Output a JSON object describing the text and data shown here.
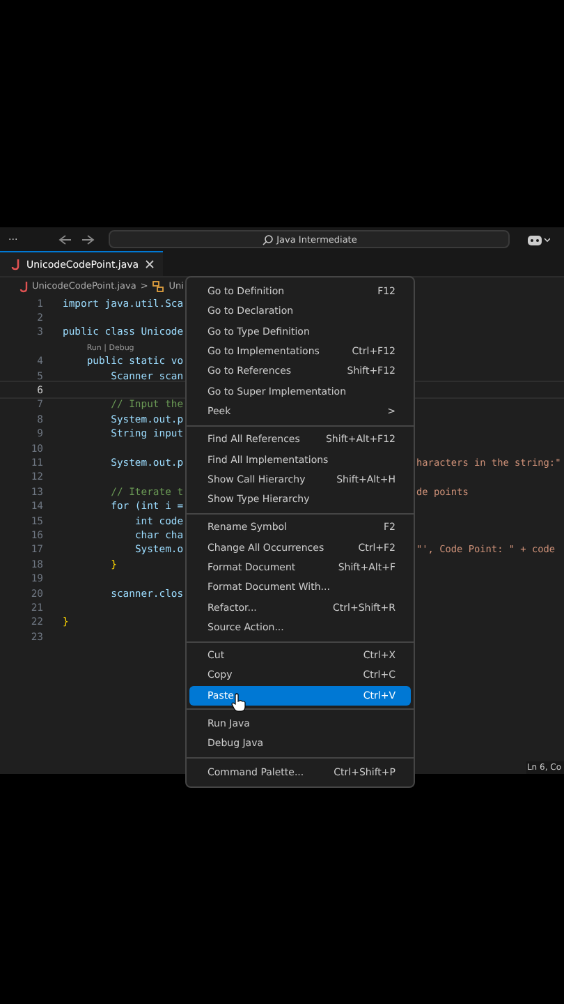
{
  "title_bar": {
    "more": "···",
    "search": "Java Intermediate"
  },
  "tabs": [
    {
      "label": "UnicodeCodePoint.java",
      "selected": true
    }
  ],
  "breadcrumb": {
    "file": "UnicodeCodePoint.java",
    "separator": ">",
    "symbol": "Uni"
  },
  "editor": {
    "lines": [
      {
        "kind": "code",
        "number": "1",
        "text": "import java.util.Sca",
        "current": false
      },
      {
        "kind": "code",
        "number": "2",
        "current": false
      },
      {
        "kind": "code",
        "number": "3",
        "text": "public class Unicode",
        "current": false
      },
      {
        "kind": "lens",
        "text": "    Run | Debug"
      },
      {
        "kind": "code",
        "number": "4",
        "text": "    public static vo",
        "current": false
      },
      {
        "kind": "code",
        "number": "5",
        "text": "        Scanner scan",
        "current": false
      },
      {
        "kind": "code",
        "number": "6",
        "current": true
      },
      {
        "kind": "code",
        "number": "7",
        "text": "        // Input the",
        "current": false
      },
      {
        "kind": "code",
        "number": "8",
        "text": "        System.out.p",
        "current": false
      },
      {
        "kind": "code",
        "number": "9",
        "text": "        String input",
        "current": false
      },
      {
        "kind": "code",
        "number": "10",
        "current": false
      },
      {
        "kind": "code",
        "number": "11",
        "text": "        System.out.p",
        "right": "haracters in the string:\"",
        "current": false
      },
      {
        "kind": "code",
        "number": "12",
        "current": false
      },
      {
        "kind": "code",
        "number": "13",
        "text": "        // Iterate t",
        "right": "de points",
        "current": false
      },
      {
        "kind": "code",
        "number": "14",
        "text": "        for (int i =",
        "current": false
      },
      {
        "kind": "code",
        "number": "15",
        "text": "            int code",
        "current": false
      },
      {
        "kind": "code",
        "number": "16",
        "text": "            char cha",
        "current": false
      },
      {
        "kind": "code",
        "number": "17",
        "text": "            System.o",
        "right": "\"', Code Point: \" + code",
        "current": false
      },
      {
        "kind": "code",
        "number": "18",
        "text": "        }",
        "current": false
      },
      {
        "kind": "code",
        "number": "19",
        "current": false
      },
      {
        "kind": "code",
        "number": "20",
        "text": "        scanner.clos",
        "current": false
      },
      {
        "kind": "code",
        "number": "21",
        "current": false
      },
      {
        "kind": "code",
        "number": "22",
        "text": "}",
        "current": false
      },
      {
        "kind": "code",
        "number": "23",
        "current": false
      }
    ]
  },
  "context_menu": {
    "groups": [
      [
        {
          "label": "Go to Definition",
          "shortcut": "F12",
          "selected": false
        },
        {
          "label": "Go to Declaration",
          "selected": false
        },
        {
          "label": "Go to Type Definition",
          "selected": false
        },
        {
          "label": "Go to Implementations",
          "shortcut": "Ctrl+F12",
          "selected": false
        },
        {
          "label": "Go to References",
          "shortcut": "Shift+F12",
          "selected": false
        },
        {
          "label": "Go to Super Implementation",
          "selected": false
        },
        {
          "label": "Peek",
          "shortcut": ">",
          "selected": false
        }
      ],
      [
        {
          "label": "Find All References",
          "shortcut": "Shift+Alt+F12",
          "selected": false
        },
        {
          "label": "Find All Implementations",
          "selected": false
        },
        {
          "label": "Show Call Hierarchy",
          "shortcut": "Shift+Alt+H",
          "selected": false
        },
        {
          "label": "Show Type Hierarchy",
          "selected": false
        }
      ],
      [
        {
          "label": "Rename Symbol",
          "shortcut": "F2",
          "selected": false
        },
        {
          "label": "Change All Occurrences",
          "shortcut": "Ctrl+F2",
          "selected": false
        },
        {
          "label": "Format Document",
          "shortcut": "Shift+Alt+F",
          "selected": false
        },
        {
          "label": "Format Document With...",
          "selected": false
        },
        {
          "label": "Refactor...",
          "shortcut": "Ctrl+Shift+R",
          "selected": false
        },
        {
          "label": "Source Action...",
          "selected": false
        }
      ],
      [
        {
          "label": "Cut",
          "shortcut": "Ctrl+X",
          "selected": false
        },
        {
          "label": "Copy",
          "shortcut": "Ctrl+C",
          "selected": false
        },
        {
          "label": "Paste",
          "shortcut": "Ctrl+V",
          "selected": true
        }
      ],
      [
        {
          "label": "Run Java",
          "selected": false
        },
        {
          "label": "Debug Java",
          "selected": false
        }
      ],
      [
        {
          "label": "Command Palette...",
          "shortcut": "Ctrl+Shift+P",
          "selected": false
        }
      ]
    ]
  },
  "status_bar": {
    "position": "Ln 6, Co"
  }
}
